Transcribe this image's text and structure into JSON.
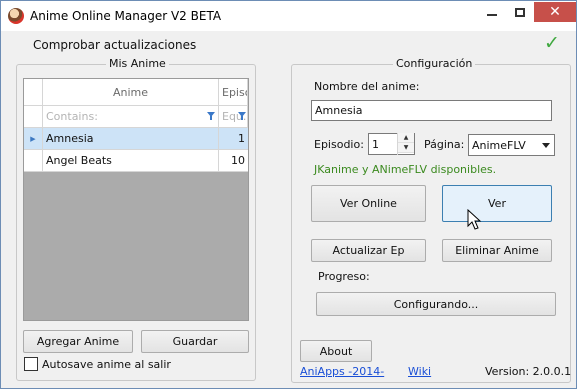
{
  "window": {
    "title": "Anime Online Manager V2 BETA",
    "icon": "app-logo-icon"
  },
  "titlebar_buttons": {
    "minimize_icon": "minimize-icon",
    "maximize_icon": "maximize-icon",
    "close": "✕"
  },
  "update": {
    "label": "Comprobar actualizaciones",
    "status_icon": "checkmark-icon",
    "status_glyph": "✓"
  },
  "my_anime": {
    "group_title": "Mis Anime",
    "columns": [
      "Anime",
      "Episodio"
    ],
    "filter_placeholders": [
      "Contains:",
      "Equ..."
    ],
    "rows": [
      {
        "anime": "Amnesia",
        "episode": "1",
        "selected": true
      },
      {
        "anime": "Angel Beats",
        "episode": "10",
        "selected": false
      }
    ],
    "add_button": "Agregar Anime",
    "save_button": "Guardar",
    "autosave_label": "Autosave anime al salir",
    "autosave_checked": false
  },
  "config": {
    "group_title": "Configuración",
    "name_label": "Nombre del anime:",
    "name_value": "Amnesia",
    "episode_label": "Episodio:",
    "episode_value": "1",
    "page_label": "Página:",
    "page_value": "AnimeFLV",
    "availability": "JKanime y ANimeFLV disponibles.",
    "watch_online_button": "Ver Online",
    "watch_button": "Ver",
    "update_ep_button": "Actualizar Ep",
    "delete_button": "Eliminar Anime",
    "progress_label": "Progreso:",
    "progress_button": "Configurando..."
  },
  "footer": {
    "about_button": "About",
    "link_aniapps": "AniApps -2014-",
    "link_wiki": "Wiki",
    "version": "Version: 2.0.0.1"
  },
  "colors": {
    "accent_blue": "#3a78c8",
    "success_green": "#3fa83f",
    "availability_green": "#3b8a1f",
    "close_red": "#c7504a",
    "selected_row": "#cde3f7"
  }
}
